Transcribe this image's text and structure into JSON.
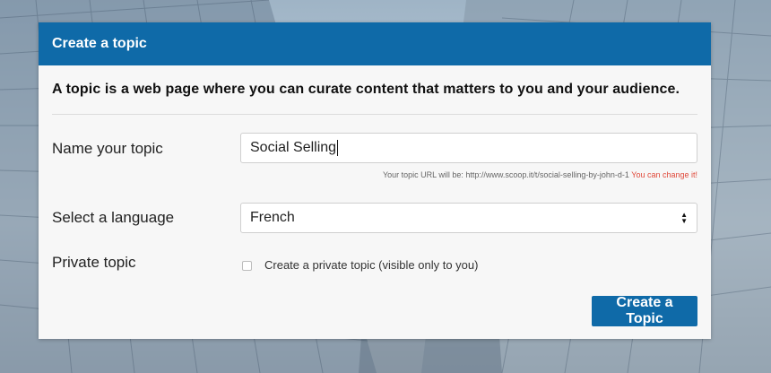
{
  "dialog": {
    "title": "Create a topic",
    "intro": "A topic is a web page where you can curate content that matters to you and your audience."
  },
  "form": {
    "name_label": "Name your topic",
    "name_value": "Social Selling",
    "url_hint_prefix": "Your topic URL will be: http://www.scoop.it/t/social-selling-by-john-d-1",
    "url_change_link": "You can change it!",
    "language_label": "Select a language",
    "language_value": "French",
    "private_label": "Private topic",
    "private_checkbox_label": "Create a private topic (visible only to you)",
    "private_checked": false,
    "submit_label": "Create a Topic"
  },
  "colors": {
    "accent": "#0f6aa8",
    "link_warning": "#e0493a",
    "panel_bg": "#f7f7f7"
  },
  "icons": {
    "select_arrows": "sort-arrows-icon"
  }
}
